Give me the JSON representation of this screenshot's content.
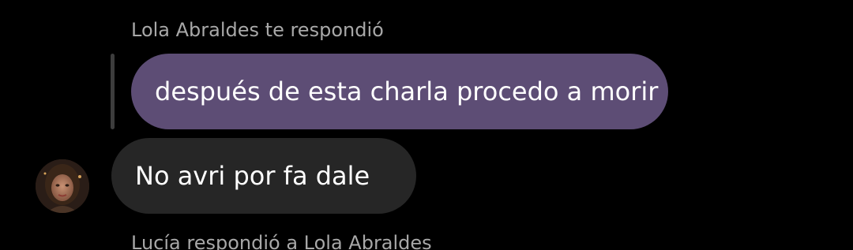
{
  "colors": {
    "background": "#000000",
    "quoted_bubble": "#5d4d75",
    "received_bubble": "#262626",
    "header_text": "#a8a8a8",
    "quote_bar": "#3d3d3d"
  },
  "conversation": {
    "reply_header": "Lola Abraldes te respondió",
    "quoted_message": "después de esta charla procedo a morir",
    "received_message": "No avri por fa dale",
    "received_avatar_icon": "profile-photo",
    "next_reply_header": "Lucía respondió a Lola Abraldes"
  }
}
